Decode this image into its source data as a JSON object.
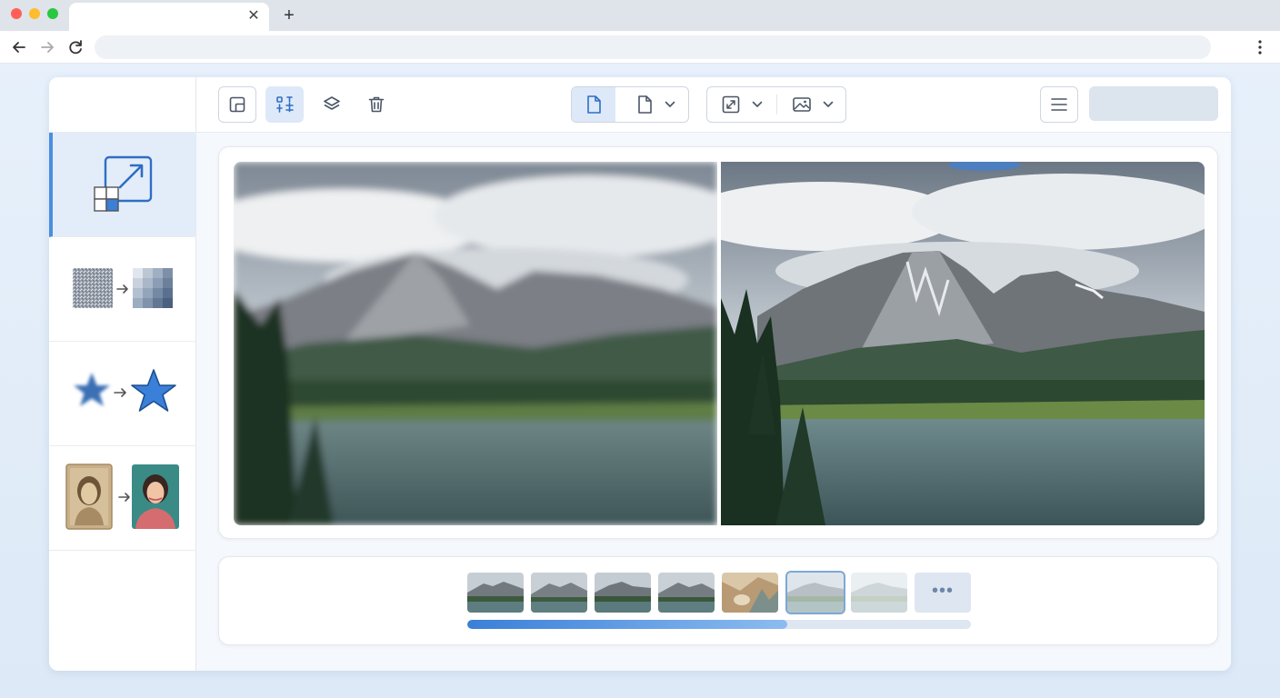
{
  "browser": {
    "tab_title": "",
    "url": "",
    "traffic_colors": [
      "#ff5f57",
      "#febc2e",
      "#28c840"
    ]
  },
  "toolbar": {
    "left_tools": [
      "crop-icon",
      "adjust-icon",
      "layers-icon",
      "trash-icon"
    ],
    "selected_tool": "adjust-icon",
    "doc_group": [
      "document-icon",
      "document-dropdown"
    ],
    "view_group": [
      "expand-dropdown",
      "image-dropdown"
    ],
    "menu_icon": "hamburger-icon"
  },
  "sidebar": {
    "items": [
      {
        "name": "upscale",
        "icon": "upscale-icon",
        "active": true
      },
      {
        "name": "denoise",
        "icon": "noise-to-pixel-icon",
        "active": false
      },
      {
        "name": "sharpen",
        "icon": "blur-star-to-sharp-star-icon",
        "active": false
      },
      {
        "name": "restore-photo",
        "icon": "old-photo-to-color-portrait-icon",
        "active": false
      }
    ]
  },
  "preview": {
    "left_label": "blurred-before",
    "right_label": "sharp-after"
  },
  "filmstrip": {
    "thumbnail_count": 7,
    "selected_index": 5,
    "more_label": "•••",
    "progress": 0.635
  },
  "colors": {
    "accent": "#3a7fd8",
    "active_sidebar": "#e3edf9",
    "selected_tool_bg": "#dde9f8"
  }
}
